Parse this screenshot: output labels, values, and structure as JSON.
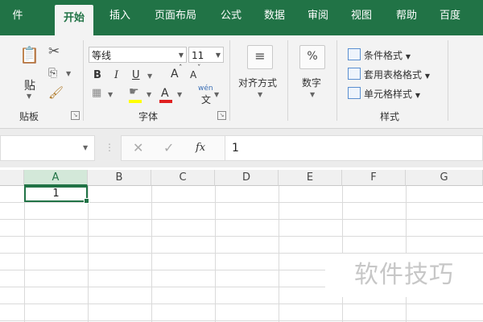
{
  "tabs": [
    {
      "label": "件"
    },
    {
      "label": "开始"
    },
    {
      "label": "插入"
    },
    {
      "label": "页面布局"
    },
    {
      "label": "公式"
    },
    {
      "label": "数据"
    },
    {
      "label": "审阅"
    },
    {
      "label": "视图"
    },
    {
      "label": "帮助"
    },
    {
      "label": "百度"
    }
  ],
  "ribbon": {
    "clipboard": {
      "paste_label": "贴",
      "group_label": "贴板"
    },
    "font": {
      "font_name": "等线",
      "font_size": "11",
      "bold": "B",
      "italic": "I",
      "underline": "U",
      "grow": "A",
      "shrink": "A",
      "font_color": "A",
      "phonetic": "wén",
      "phonetic_char": "文",
      "group_label": "字体"
    },
    "alignment": {
      "label": "对齐方式"
    },
    "number": {
      "symbol": "%",
      "label": "数字"
    },
    "styles": {
      "items": [
        "条件格式",
        "套用表格格式",
        "单元格样式"
      ],
      "group_label": "样式"
    }
  },
  "formula_bar": {
    "fx": "fx",
    "value": "1"
  },
  "grid": {
    "columns": [
      "A",
      "B",
      "C",
      "D",
      "E",
      "F",
      "G"
    ],
    "a1_value": "1"
  },
  "watermark": "软件技巧",
  "colors": {
    "accent": "#217346"
  }
}
